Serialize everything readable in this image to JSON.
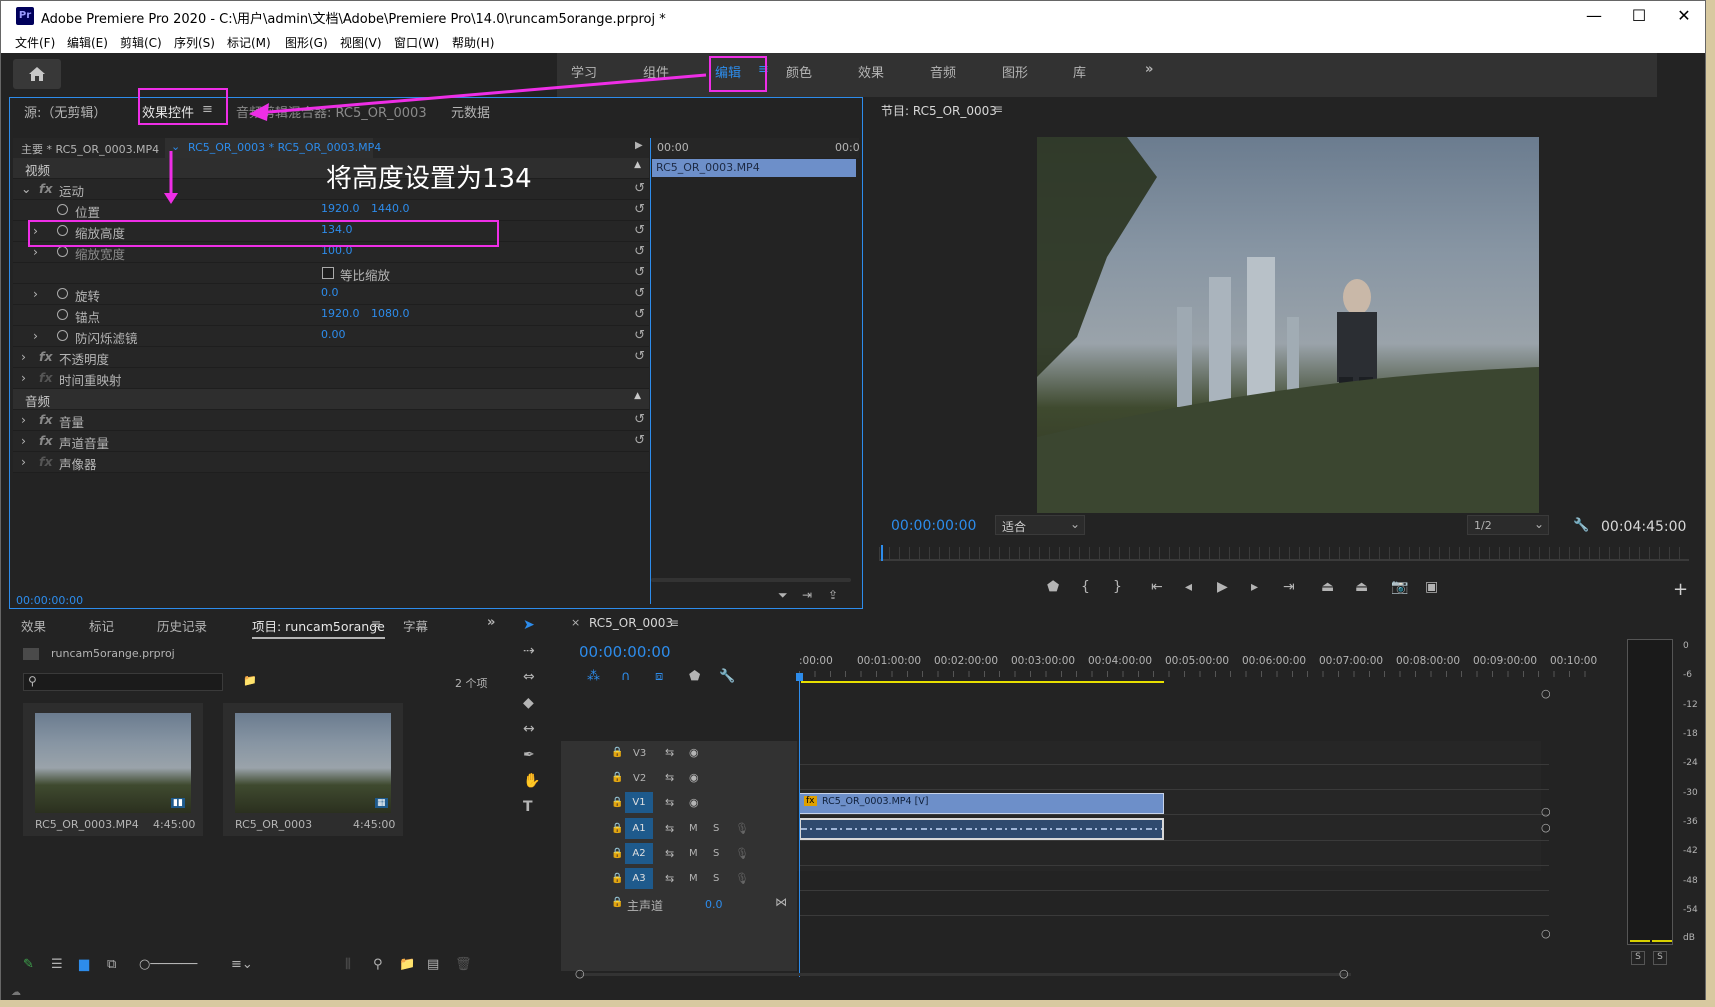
{
  "window": {
    "title": "Adobe Premiere Pro 2020 - C:\\用户\\admin\\文档\\Adobe\\Premiere Pro\\14.0\\runcam5orange.prproj *",
    "logo": "Pr"
  },
  "menu": [
    "文件(F)",
    "编辑(E)",
    "剪辑(C)",
    "序列(S)",
    "标记(M)",
    "图形(G)",
    "视图(V)",
    "窗口(W)",
    "帮助(H)"
  ],
  "workspaces": [
    "学习",
    "组件",
    "编辑",
    "颜色",
    "效果",
    "音频",
    "图形",
    "库"
  ],
  "source_panel": {
    "tabs": [
      "源:（无剪辑）",
      "效果控件",
      "音频剪辑混合器: RC5_OR_0003",
      "元数据"
    ],
    "master_clip": "主要 * RC5_OR_0003.MP4",
    "sequence_clip": "RC5_OR_0003 * RC5_OR_0003.MP4",
    "annotation": "将高度设置为134",
    "ruler_start": "00:00",
    "ruler_end": "00:0",
    "clip_bar": "RC5_OR_0003.MP4",
    "timecode": "00:00:00:00",
    "sections": {
      "video": "视频",
      "audio": "音频"
    },
    "params": [
      {
        "name": "运动",
        "fx": true
      },
      {
        "name": "位置",
        "v1": "1920.0",
        "v2": "1440.0"
      },
      {
        "name": "缩放高度",
        "v1": "134.0"
      },
      {
        "name": "缩放宽度",
        "v1": "100.0"
      },
      {
        "name": "等比缩放"
      },
      {
        "name": "旋转",
        "v1": "0.0"
      },
      {
        "name": "锚点",
        "v1": "1920.0",
        "v2": "1080.0"
      },
      {
        "name": "防闪烁滤镜",
        "v1": "0.00"
      },
      {
        "name": "不透明度",
        "fx": true
      },
      {
        "name": "时间重映射",
        "fx": true
      },
      {
        "name": "音量",
        "fx": true
      },
      {
        "name": "声道音量",
        "fx": true
      },
      {
        "name": "声像器",
        "fx": true
      }
    ]
  },
  "program_monitor": {
    "title": "节目: RC5_OR_0003",
    "timecode": "00:00:00:00",
    "fit": "适合",
    "resolution": "1/2",
    "duration": "00:04:45:00"
  },
  "project_panel": {
    "tabs": [
      "效果",
      "标记",
      "历史记录",
      "项目: runcam5orange",
      "字幕"
    ],
    "project_file": "runcam5orange.prproj",
    "item_count": "2 个项",
    "items": [
      {
        "name": "RC5_OR_0003.MP4",
        "duration": "4:45:00"
      },
      {
        "name": "RC5_OR_0003",
        "duration": "4:45:00"
      }
    ]
  },
  "timeline": {
    "tab": "RC5_OR_0003",
    "timecode": "00:00:00:00",
    "ruler": [
      ":00:00",
      "00:01:00:00",
      "00:02:00:00",
      "00:03:00:00",
      "00:04:00:00",
      "00:05:00:00",
      "00:06:00:00",
      "00:07:00:00",
      "00:08:00:00",
      "00:09:00:00",
      "00:10:00"
    ],
    "video_tracks": [
      "V3",
      "V2",
      "V1"
    ],
    "audio_tracks": [
      "A1",
      "A2",
      "A3"
    ],
    "master": {
      "label": "主声道",
      "value": "0.0"
    },
    "video_clip": "RC5_OR_0003.MP4 [V]",
    "track_mute": "M",
    "track_solo": "S"
  },
  "meter": {
    "scale": [
      "0",
      "-6",
      "-12",
      "-18",
      "-24",
      "-30",
      "-36",
      "-42",
      "-48",
      "-54",
      "dB"
    ],
    "solo": [
      "S",
      "S"
    ]
  },
  "colors": {
    "accent": "#2d8ceb",
    "highlight": "#ee2ee6",
    "clip_video": "#6d8fc9",
    "playhead": "#2d8ceb"
  }
}
